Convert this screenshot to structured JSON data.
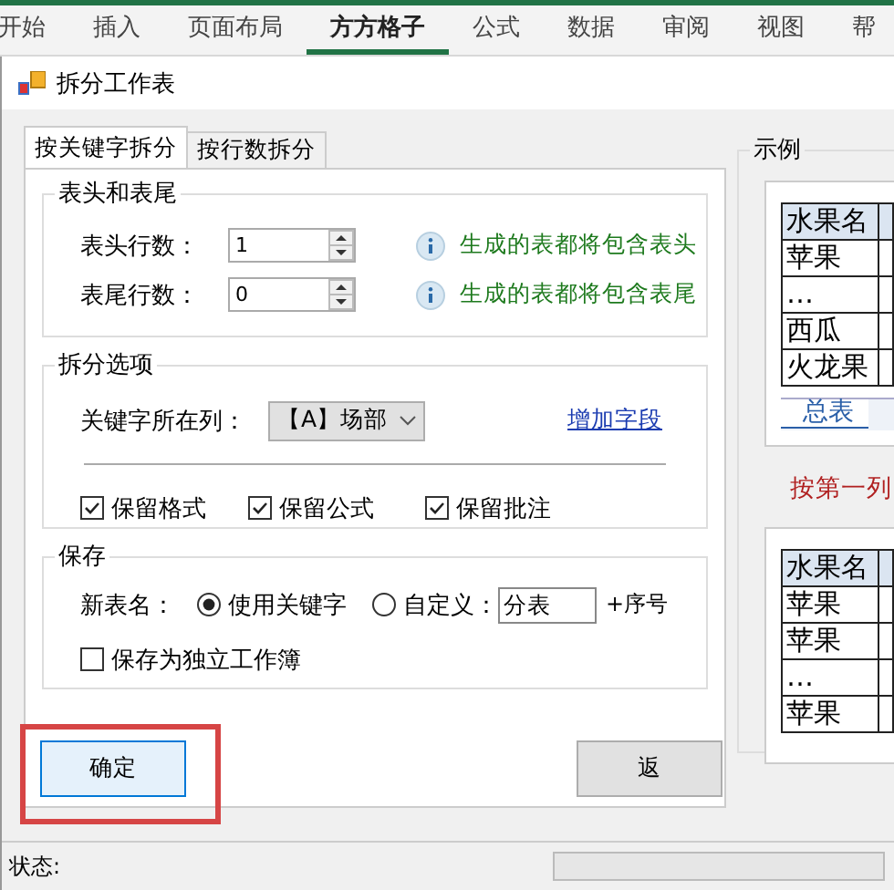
{
  "ribbon": {
    "tabs": [
      {
        "label": "开始",
        "selected": false
      },
      {
        "label": "插入",
        "selected": false
      },
      {
        "label": "页面布局",
        "selected": false
      },
      {
        "label": "方方格子",
        "selected": true
      },
      {
        "label": "公式",
        "selected": false
      },
      {
        "label": "数据",
        "selected": false
      },
      {
        "label": "审阅",
        "selected": false
      },
      {
        "label": "视图",
        "selected": false
      },
      {
        "label": "帮",
        "selected": false
      }
    ]
  },
  "dialog": {
    "title": "拆分工作表",
    "tabs": [
      {
        "label": "按关键字拆分",
        "selected": true
      },
      {
        "label": "按行数拆分",
        "selected": false
      }
    ],
    "header_footer": {
      "title": "表头和表尾",
      "rows": [
        {
          "label": "表头行数：",
          "value": "1",
          "hint": "生成的表都将包含表头"
        },
        {
          "label": "表尾行数：",
          "value": "0",
          "hint": "生成的表都将包含表尾"
        }
      ]
    },
    "split_options": {
      "title": "拆分选项",
      "keyword_label": "关键字所在列：",
      "keyword_column": "【A】场部",
      "add_field_link": "增加字段",
      "checkboxes": [
        {
          "label": "保留格式",
          "checked": true
        },
        {
          "label": "保留公式",
          "checked": true
        },
        {
          "label": "保留批注",
          "checked": true
        }
      ]
    },
    "save": {
      "title": "保存",
      "name_label": "新表名：",
      "options": [
        {
          "label": "使用关键字",
          "selected": true
        },
        {
          "label": "自定义：",
          "selected": false
        }
      ],
      "custom_name": "分表",
      "suffix": "+序号",
      "separate_workbook": {
        "label": "保存为独立工作簿",
        "checked": false
      }
    },
    "buttons": [
      {
        "label": "确定",
        "default": true,
        "highlighted": true
      },
      {
        "label": "返",
        "default": false,
        "highlighted": false
      }
    ],
    "status_label": "状态:",
    "status_progress": {
      "level": 0
    }
  },
  "example": {
    "title": "示例",
    "source_table": {
      "header": "水果名",
      "rows": [
        "苹果",
        "…",
        "西瓜",
        "火龙果"
      ],
      "sheet_tab": "总表"
    },
    "caption": "按第一列",
    "result_table": {
      "header": "水果名",
      "rows": [
        "苹果",
        "苹果",
        "…",
        "苹果"
      ]
    }
  }
}
